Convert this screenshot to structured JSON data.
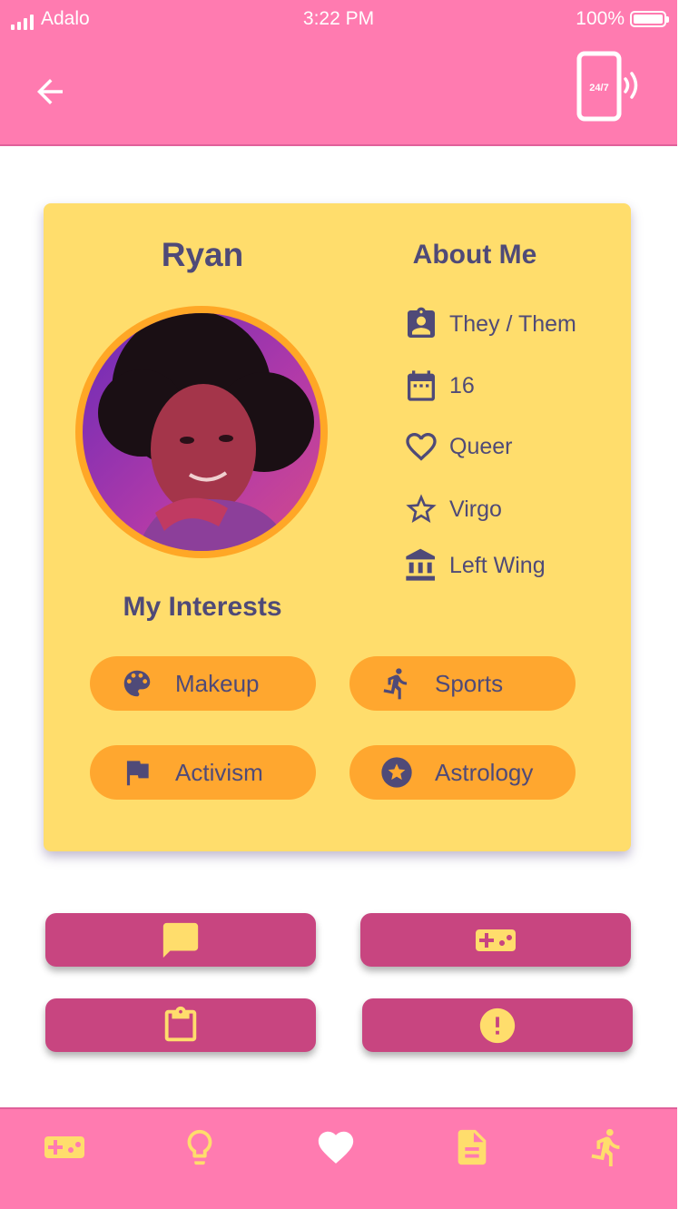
{
  "status_bar": {
    "carrier": "Adalo",
    "time": "3:22 PM",
    "battery": "100%"
  },
  "header": {
    "back_icon": "arrow-left-icon",
    "support_icon": "phone-24-7-icon",
    "support_text": "24/7"
  },
  "profile": {
    "name": "Ryan",
    "photo_icon": "avatar-photo",
    "about_title": "About Me",
    "about": [
      {
        "icon": "badge-icon",
        "label": "They / Them"
      },
      {
        "icon": "calendar-icon",
        "label": "16"
      },
      {
        "icon": "heart-outline-icon",
        "label": "Queer"
      },
      {
        "icon": "star-outline-icon",
        "label": "Virgo"
      },
      {
        "icon": "bank-icon",
        "label": "Left Wing"
      }
    ],
    "interests_title": "My Interests",
    "interests": [
      {
        "icon": "palette-icon",
        "label": "Makeup"
      },
      {
        "icon": "run-icon",
        "label": "Sports"
      },
      {
        "icon": "flag-icon",
        "label": "Activism"
      },
      {
        "icon": "star-circle-icon",
        "label": "Astrology"
      }
    ]
  },
  "actions": [
    {
      "icon": "message-icon"
    },
    {
      "icon": "gamepad-icon"
    },
    {
      "icon": "clipboard-icon"
    },
    {
      "icon": "alert-circle-icon"
    }
  ],
  "bottom_nav": [
    {
      "icon": "gamepad-icon"
    },
    {
      "icon": "lightbulb-icon"
    },
    {
      "icon": "heart-icon",
      "active": true
    },
    {
      "icon": "document-icon"
    },
    {
      "icon": "run-icon"
    }
  ],
  "colors": {
    "header": "#ff7bb0",
    "card": "#ffdd6c",
    "chip": "#ffa72f",
    "text": "#4f4a78",
    "action_button": "#c84580",
    "action_icon": "#ffdd6c",
    "nav_icon": "#ffdd6c"
  }
}
